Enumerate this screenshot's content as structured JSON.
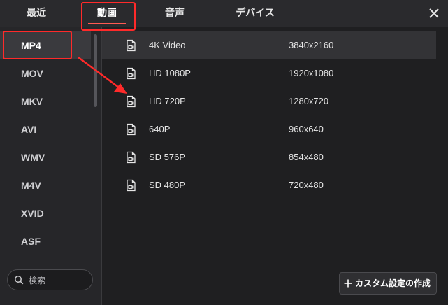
{
  "tabs": [
    {
      "label": "最近"
    },
    {
      "label": "動画"
    },
    {
      "label": "音声"
    },
    {
      "label": "デバイス"
    }
  ],
  "active_tab": "動画",
  "formats": [
    "MP4",
    "MOV",
    "MKV",
    "AVI",
    "WMV",
    "M4V",
    "XVID",
    "ASF"
  ],
  "selected_format": "MP4",
  "search": {
    "placeholder": "検索"
  },
  "presets": [
    {
      "name": "4K Video",
      "resolution": "3840x2160"
    },
    {
      "name": "HD 1080P",
      "resolution": "1920x1080"
    },
    {
      "name": "HD 720P",
      "resolution": "1280x720"
    },
    {
      "name": "640P",
      "resolution": "960x640"
    },
    {
      "name": "SD 576P",
      "resolution": "854x480"
    },
    {
      "name": "SD 480P",
      "resolution": "720x480"
    }
  ],
  "selected_preset": "4K Video",
  "custom_button": {
    "label": "カスタム設定の作成"
  },
  "colors": {
    "accent": "#ff5a52",
    "highlight_box": "#ff2a2a",
    "background": "#1f1f21"
  }
}
